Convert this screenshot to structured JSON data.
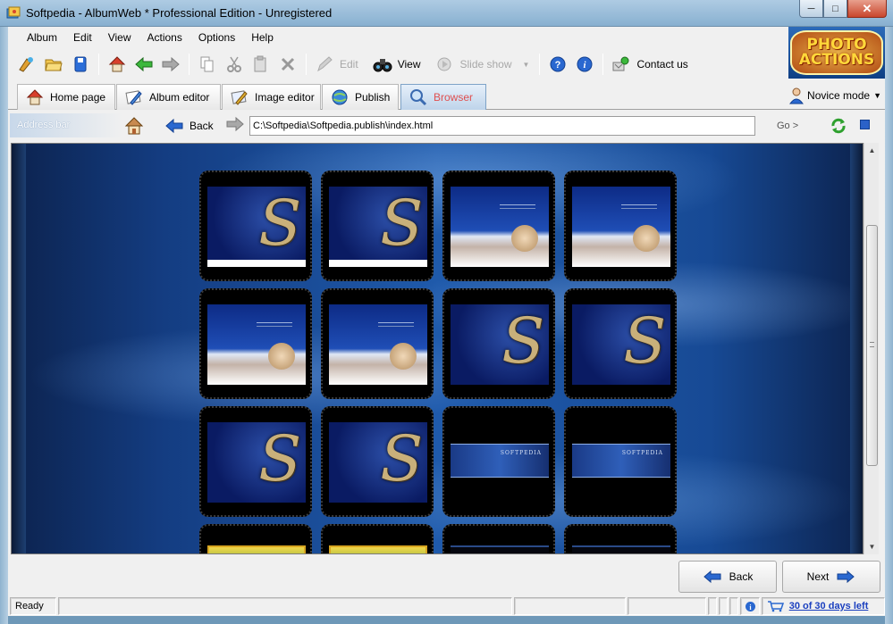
{
  "window": {
    "title": "Softpedia - AlbumWeb * Professional Edition - Unregistered",
    "app_icon": "albumweb-app-icon"
  },
  "menu": [
    "Album",
    "Edit",
    "View",
    "Actions",
    "Options",
    "Help"
  ],
  "toolbar": {
    "edit_label": "Edit",
    "view_label": "View",
    "slideshow_label": "Slide show",
    "contact_label": "Contact us"
  },
  "logo": {
    "line1": "PHOTO",
    "line2": "ACTIONS"
  },
  "tabs": [
    {
      "label": "Home page",
      "icon": "home-icon"
    },
    {
      "label": "Album editor",
      "icon": "album-editor-icon"
    },
    {
      "label": "Image editor",
      "icon": "image-editor-icon"
    },
    {
      "label": "Publish",
      "icon": "publish-icon"
    },
    {
      "label": "Browser",
      "icon": "browser-icon",
      "active": true
    }
  ],
  "mode": {
    "label": "Novice mode"
  },
  "address": {
    "label": "Address bar",
    "back_label": "Back",
    "url": "C:\\Softpedia\\Softpedia.publish\\index.html",
    "go_label": "Go >"
  },
  "gallery": {
    "thumbnails": [
      "s-logo",
      "s-logo",
      "woman",
      "woman",
      "woman",
      "woman",
      "s-logo",
      "s-logo",
      "s-logo",
      "s-logo",
      "banner",
      "banner",
      "green-banner",
      "green-banner",
      "dark-banner",
      "dark-banner"
    ]
  },
  "nav": {
    "back_label": "Back",
    "next_label": "Next"
  },
  "status": {
    "ready": "Ready",
    "trial": "30 of 30 days left"
  },
  "colors": {
    "active_tab_text": "#e05050",
    "link": "#1a3fbf",
    "browser_bg": "#1f5aab"
  }
}
